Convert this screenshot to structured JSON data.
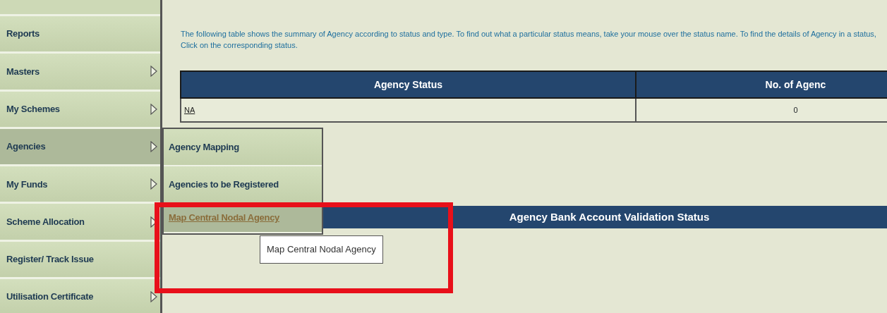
{
  "sidebar": {
    "items": [
      {
        "label": "Reports",
        "has_submenu": false,
        "selected": false
      },
      {
        "label": "Masters",
        "has_submenu": true,
        "selected": false
      },
      {
        "label": "My Schemes",
        "has_submenu": true,
        "selected": false
      },
      {
        "label": "Agencies",
        "has_submenu": true,
        "selected": true
      },
      {
        "label": "My Funds",
        "has_submenu": true,
        "selected": false
      },
      {
        "label": "Scheme Allocation",
        "has_submenu": true,
        "selected": false
      },
      {
        "label": "Register/ Track Issue",
        "has_submenu": false,
        "selected": false
      },
      {
        "label": "Utilisation Certificate",
        "has_submenu": true,
        "selected": false
      }
    ]
  },
  "submenu": {
    "items": [
      {
        "label": "Agency Mapping",
        "hovered": false
      },
      {
        "label": "Agencies to be Registered",
        "hovered": false
      },
      {
        "label": "Map Central Nodal Agency",
        "hovered": true
      }
    ]
  },
  "tooltip": "Map Central Nodal Agency",
  "intro": "The following table shows the summary of Agency according to status and type. To find out what a particular status means, take your mouse over the status name. To find the details of Agency in a status, Click on the corresponding status.",
  "status_table": {
    "columns": [
      "Agency Status",
      "No. of Agenc"
    ],
    "rows": [
      [
        "NA",
        "0"
      ]
    ]
  },
  "validation_table": {
    "title": "Agency Bank Account Validation Status"
  },
  "highlight_box": true
}
